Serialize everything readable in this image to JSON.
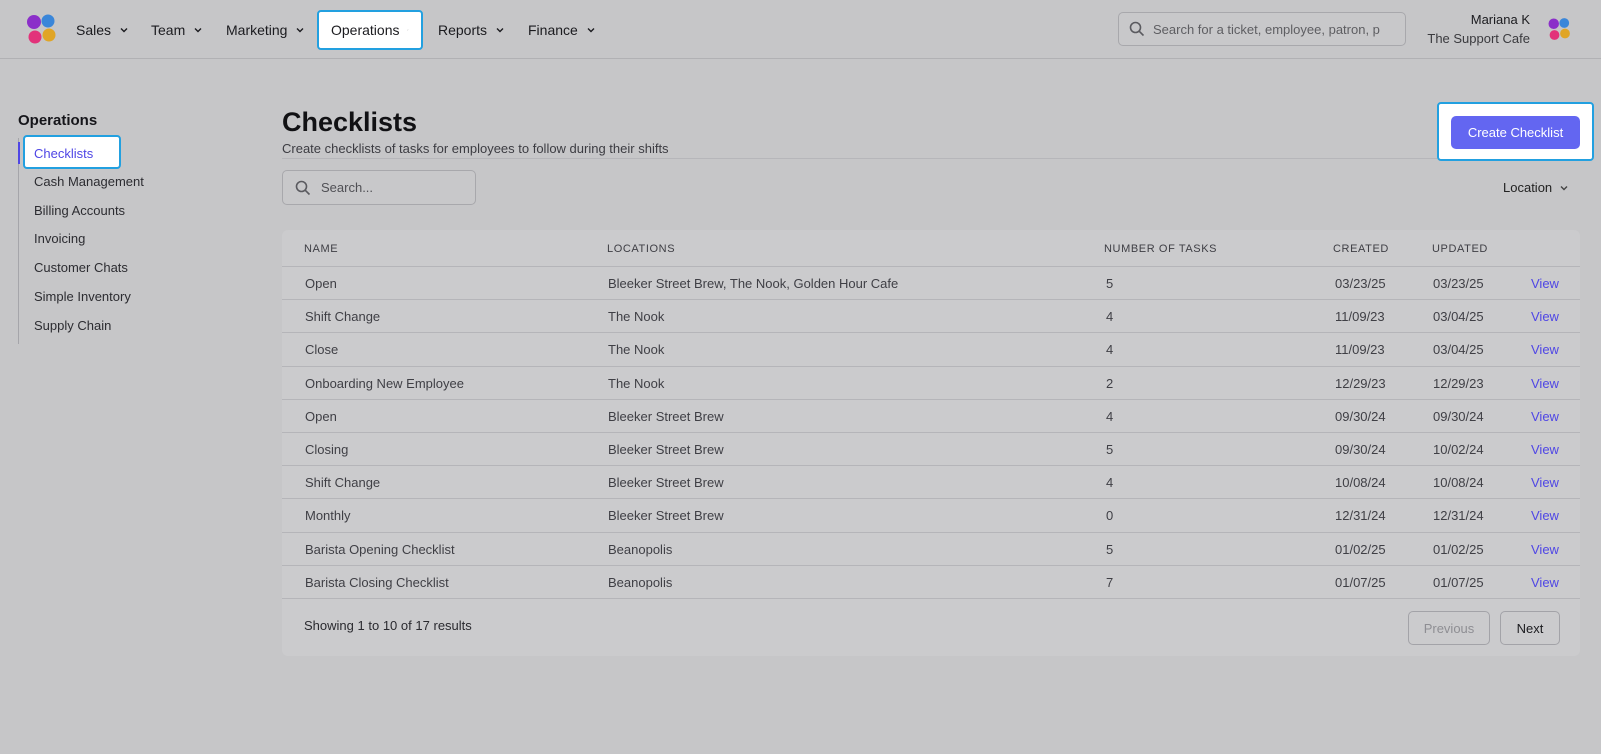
{
  "nav": {
    "items": [
      {
        "label": "Sales"
      },
      {
        "label": "Team"
      },
      {
        "label": "Marketing"
      },
      {
        "label": "Operations"
      },
      {
        "label": "Reports"
      },
      {
        "label": "Finance"
      }
    ],
    "active": "Operations",
    "search_placeholder": "Search for a ticket, employee, patron, p",
    "user_name": "Mariana K",
    "user_org": "The Support Cafe"
  },
  "sidebar": {
    "title": "Operations",
    "items": [
      {
        "label": "Checklists"
      },
      {
        "label": "Cash Management"
      },
      {
        "label": "Billing Accounts"
      },
      {
        "label": "Invoicing"
      },
      {
        "label": "Customer Chats"
      },
      {
        "label": "Simple Inventory"
      },
      {
        "label": "Supply Chain"
      }
    ]
  },
  "main": {
    "title": "Checklists",
    "subtitle": "Create checklists of tasks for employees to follow during their shifts",
    "create_label": "Create Checklist",
    "search_placeholder": "Search...",
    "location_filter": "Location"
  },
  "table": {
    "headers": [
      "Name",
      "Locations",
      "Number of Tasks",
      "Created",
      "Updated"
    ],
    "view_label": "View",
    "rows": [
      {
        "name": "Open",
        "locations": "Bleeker Street Brew, The Nook, Golden Hour Cafe",
        "tasks": "5",
        "created": "03/23/25",
        "updated": "03/23/25"
      },
      {
        "name": "Shift Change",
        "locations": "The Nook",
        "tasks": "4",
        "created": "11/09/23",
        "updated": "03/04/25"
      },
      {
        "name": "Close",
        "locations": "The Nook",
        "tasks": "4",
        "created": "11/09/23",
        "updated": "03/04/25"
      },
      {
        "name": "Onboarding New Employee",
        "locations": "The Nook",
        "tasks": "2",
        "created": "12/29/23",
        "updated": "12/29/23"
      },
      {
        "name": "Open",
        "locations": "Bleeker Street Brew",
        "tasks": "4",
        "created": "09/30/24",
        "updated": "09/30/24"
      },
      {
        "name": "Closing",
        "locations": "Bleeker Street Brew",
        "tasks": "5",
        "created": "09/30/24",
        "updated": "10/02/24"
      },
      {
        "name": "Shift Change",
        "locations": "Bleeker Street Brew",
        "tasks": "4",
        "created": "10/08/24",
        "updated": "10/08/24"
      },
      {
        "name": "Monthly",
        "locations": "Bleeker Street Brew",
        "tasks": "0",
        "created": "12/31/24",
        "updated": "12/31/24"
      },
      {
        "name": "Barista Opening Checklist",
        "locations": "Beanopolis",
        "tasks": "5",
        "created": "01/02/25",
        "updated": "01/02/25"
      },
      {
        "name": "Barista Closing Checklist",
        "locations": "Beanopolis",
        "tasks": "7",
        "created": "01/07/25",
        "updated": "01/07/25"
      }
    ]
  },
  "pagination": {
    "showing_prefix": "Showing",
    "from": "1",
    "to_word": "to",
    "to": "10",
    "of_word": "of",
    "total": "17",
    "results_word": "results",
    "previous_label": "Previous",
    "next_label": "Next"
  },
  "colors": {
    "accent": "#6366f1",
    "link": "#4f46e5",
    "highlight_border": "#22a0e0"
  },
  "icons": {
    "logo": "pinwheel-logo-icon",
    "search": "search-icon",
    "chevron": "chevron-down-icon"
  }
}
